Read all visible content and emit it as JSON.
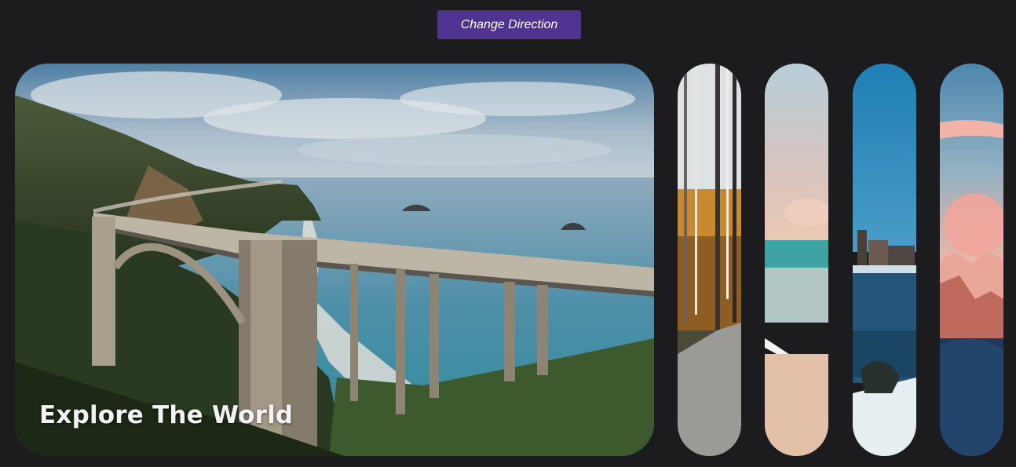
{
  "toolbar": {
    "change_direction_label": "Change Direction"
  },
  "gallery": {
    "active_caption": "Explore The World",
    "panels": [
      {
        "id": "coastal-bridge",
        "expanded": true
      },
      {
        "id": "autumn-forest-path",
        "expanded": false
      },
      {
        "id": "sunset-beach",
        "expanded": false
      },
      {
        "id": "snowy-lakeside-city",
        "expanded": false
      },
      {
        "id": "pink-mountains",
        "expanded": false
      }
    ]
  },
  "colors": {
    "background": "#1c1b1e",
    "button": "#4f3391",
    "caption": "#f2f2f2"
  }
}
